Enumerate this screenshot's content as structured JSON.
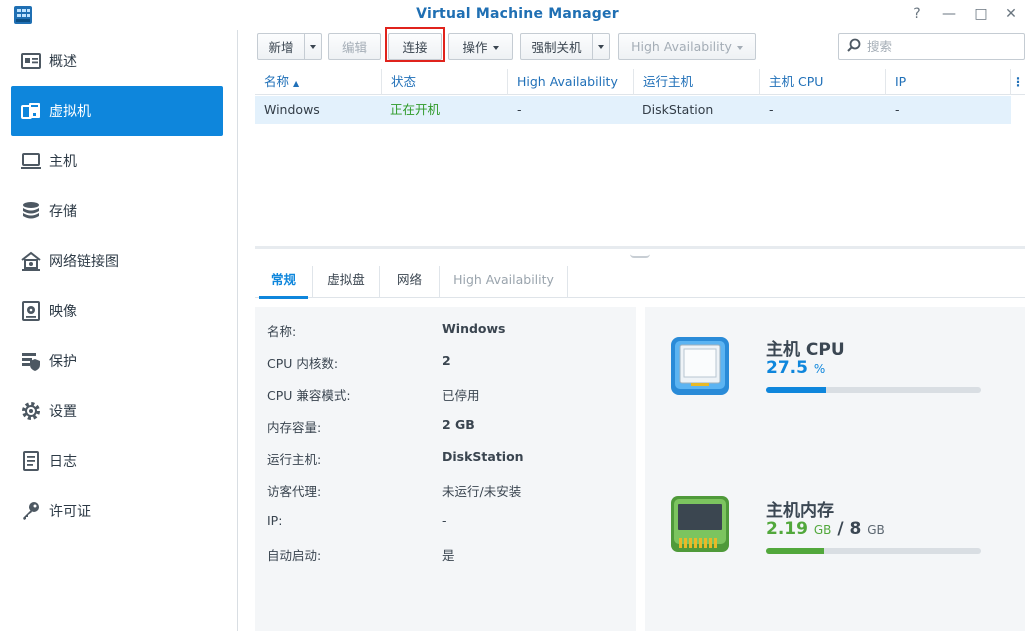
{
  "window": {
    "title": "Virtual Machine Manager",
    "help_glyph": "?",
    "minimize_glyph": "—",
    "maximize_glyph": "□",
    "close_glyph": "✕"
  },
  "sidebar": {
    "items": [
      {
        "label": "概述",
        "icon": "overview-icon"
      },
      {
        "label": "虚拟机",
        "icon": "virtual-machine-icon",
        "active": true
      },
      {
        "label": "主机",
        "icon": "host-icon"
      },
      {
        "label": "存储",
        "icon": "storage-icon"
      },
      {
        "label": "网络链接图",
        "icon": "network-icon"
      },
      {
        "label": "映像",
        "icon": "image-icon"
      },
      {
        "label": "保护",
        "icon": "protection-icon"
      },
      {
        "label": "设置",
        "icon": "gear-icon"
      },
      {
        "label": "日志",
        "icon": "log-icon"
      },
      {
        "label": "许可证",
        "icon": "key-icon"
      }
    ]
  },
  "toolbar": {
    "create_label": "新增",
    "edit_label": "编辑",
    "connect_label": "连接",
    "action_label": "操作",
    "force_shutdown_label": "强制关机",
    "high_availability_label": "High Availability",
    "search_placeholder": "搜索"
  },
  "grid": {
    "columns": [
      "名称",
      "状态",
      "High Availability",
      "运行主机",
      "主机 CPU",
      "IP"
    ],
    "rows": [
      {
        "name": "Windows",
        "status": "正在开机",
        "ha": "-",
        "host": "DiskStation",
        "cpu": "-",
        "ip": "-"
      }
    ]
  },
  "tabs": [
    "常规",
    "虚拟盘",
    "网络",
    "High Availability"
  ],
  "details": {
    "labels": [
      "名称:",
      "CPU 内核数:",
      "CPU 兼容模式:",
      "内存容量:",
      "运行主机:",
      "访客代理:",
      "IP:",
      "自动启动:"
    ],
    "values": [
      "Windows",
      "2",
      "已停用",
      "2 GB",
      "DiskStation",
      "未运行/未安装",
      "-",
      "是"
    ]
  },
  "resources": {
    "cpu_title": "主机 CPU",
    "cpu_value": "27.5",
    "cpu_unit": "%",
    "cpu_fraction": 0.275,
    "mem_title": "主机内存",
    "mem_used": "2.19",
    "mem_used_unit": "GB",
    "mem_separator": "/",
    "mem_total": "8",
    "mem_total_unit": "GB",
    "mem_fraction": 0.27
  },
  "colors": {
    "accent": "#0e86dc",
    "status_green": "#2e9a28",
    "memory_green": "#52a83c",
    "highlight_red": "#e0231c"
  }
}
